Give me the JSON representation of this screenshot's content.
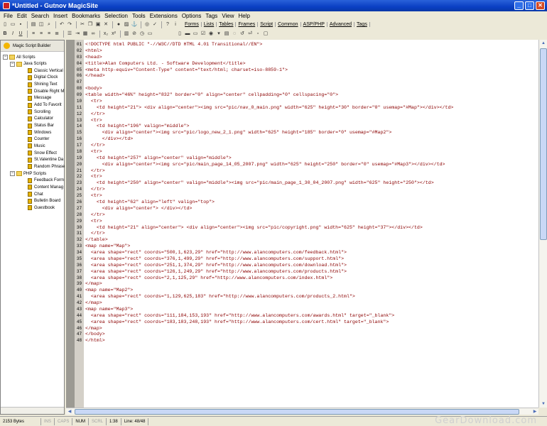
{
  "window": {
    "title": "*Untitled - Gutnov MagicSite"
  },
  "menu": [
    "File",
    "Edit",
    "Search",
    "Insert",
    "Bookmarks",
    "Selection",
    "Tools",
    "Extensions",
    "Options",
    "Tags",
    "View",
    "Help"
  ],
  "toolbar_tabs": [
    "Forms",
    "Lists",
    "Tables",
    "Frames",
    "Script",
    "Common",
    "ASP/PHP",
    "Advanced",
    "Tags"
  ],
  "sidebar": {
    "header": "Magic Script Builder",
    "root": "All Scripts",
    "groups": [
      {
        "label": "Java Scripts",
        "items": [
          "Classic Vertical",
          "Digital Clock",
          "Shining Text",
          "Disable Right M",
          "Message",
          "Add To Favorit",
          "Scrolling",
          "Calculator",
          "Status Bar",
          "Windows",
          "Counter",
          "Music",
          "Snow Effect",
          "St.Valentine Da",
          "Random Phrase"
        ]
      },
      {
        "label": "PHP Scripts",
        "items": [
          "Feedback Form",
          "Content Manag",
          "Chat",
          "Bulletin Board",
          "Guestbook"
        ]
      }
    ]
  },
  "code_lines": [
    "<!DOCTYPE html PUBLIC \"-//W3C//DTD HTML 4.01 Transitional//EN\">",
    "<html>",
    "<head>",
    "<title>Alan Computers Ltd. - Software Development</title>",
    "<meta http-equiv=\"Content-Type\" content=\"text/html; charset=iso-8859-1\">",
    "</head>",
    "",
    "<body>",
    "<table width=\"46%\" height=\"832\" border=\"0\" align=\"center\" cellpadding=\"0\" cellspacing=\"0\">",
    "  <tr>",
    "    <td height=\"21\"> <div align=\"center\"><img src=\"pic/nav_0_main.png\" width=\"625\" height=\"30\" border=\"0\" usemap=\"#Map\"></div></td>",
    "  </tr>",
    "  <tr>",
    "    <td height=\"196\" valign=\"middle\">",
    "      <div align=\"center\"><img src=\"pic/logo_new_2_1.png\" width=\"625\" height=\"185\" border=\"0\" usemap=\"#Map2\">",
    "      </div></td>",
    "  </tr>",
    "  <tr>",
    "    <td height=\"257\" align=\"center\" valign=\"middle\">",
    "      <div align=\"center\"><img src=\"pic/main_page_14_05_2007.png\" width=\"625\" height=\"250\" border=\"0\" usemap=\"#Map3\"></div></td>",
    "  </tr>",
    "  <tr>",
    "    <td height=\"250\" align=\"center\" valign=\"middle\"><img src=\"pic/main_page_1_30_04_2007.png\" width=\"625\" height=\"250\"></td>",
    "  </tr>",
    "  <tr>",
    "    <td height=\"62\" align=\"left\" valign=\"top\">",
    "      <div align=\"center\"> </div></td>",
    "  </tr>",
    "  <tr>",
    "    <td height=\"21\" align=\"center\"> <div align=\"center\"><img src=\"pic/copyright.png\" width=\"625\" height=\"37\"></div></td>",
    "  </tr>",
    "</table>",
    "<map name=\"Map\">",
    "  <area shape=\"rect\" coords=\"500,1,623,29\" href=\"http://www.alancomputers.com/feedback.html\">",
    "  <area shape=\"rect\" coords=\"376,1,499,29\" href=\"http://www.alancomputers.com/support.html\">",
    "  <area shape=\"rect\" coords=\"251,1,374,29\" href=\"http://www.alancomputers.com/download.html\">",
    "  <area shape=\"rect\" coords=\"126,1,249,29\" href=\"http://www.alancomputers.com/products.html\">",
    "  <area shape=\"rect\" coords=\"2,1,125,29\" href=\"http://www.alancomputers.com/index.html\">",
    "</map>",
    "<map name=\"Map2\">",
    "  <area shape=\"rect\" coords=\"1,129,625,183\" href=\"http://www.alancomputers.com/products_2.html\">",
    "</map>",
    "<map name=\"Map3\">",
    "  <area shape=\"rect\" coords=\"111,184,153,193\" href=\"http://www.alancomputers.com/awards.html\" target=\"_blank\">",
    "  <area shape=\"rect\" coords=\"183,183,248,193\" href=\"http://www.alancomputers.com/cert.html\" target=\"_blank\">",
    "</map>",
    "</body>",
    "</html>"
  ],
  "status": {
    "size": "2153 Bytes",
    "ins": "INS",
    "caps": "CAPS",
    "num": "NUM",
    "scrl": "SCRL",
    "pos": "1:38",
    "line": "Line: 48/48"
  },
  "watermark": "GearDownload.com"
}
